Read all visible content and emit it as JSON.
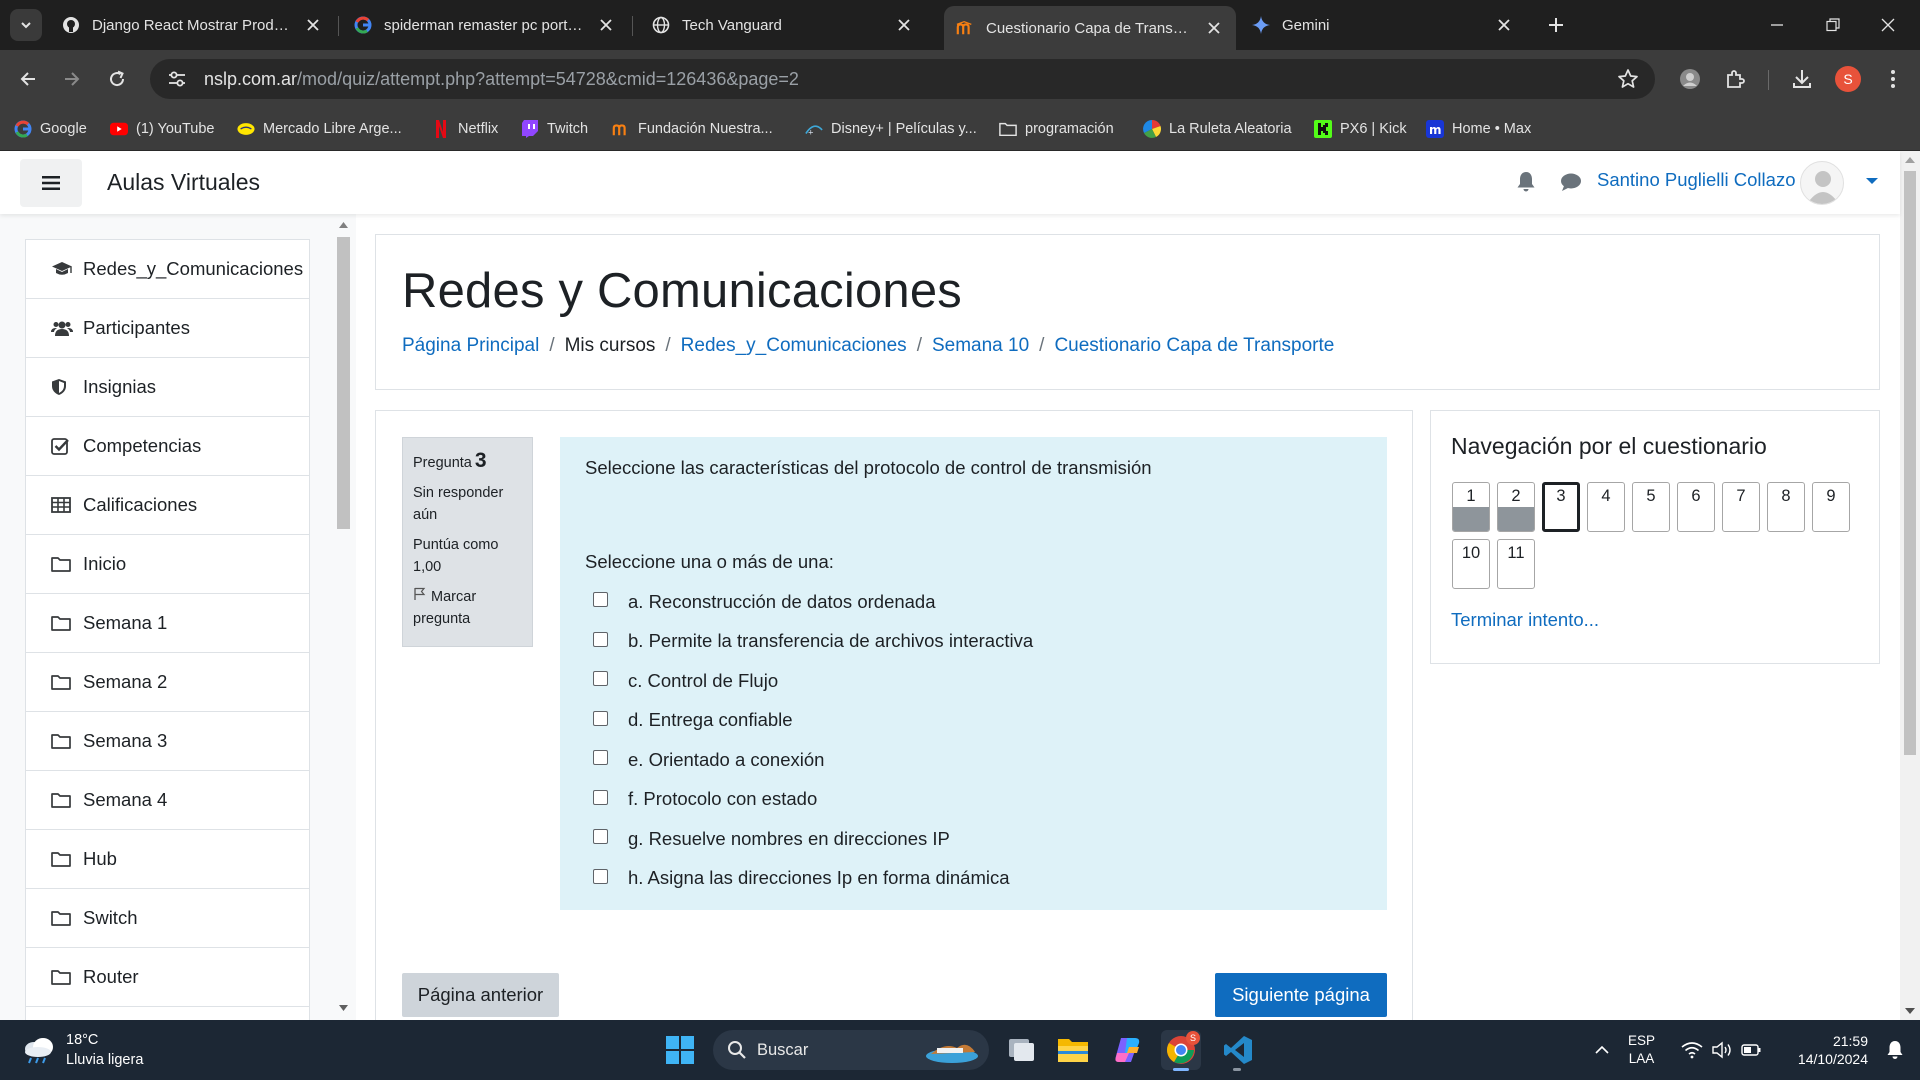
{
  "browser": {
    "tabs": [
      {
        "title": "Django React Mostrar Producto",
        "icon": "github-icon"
      },
      {
        "title": "spiderman remaster pc portada",
        "icon": "google-icon"
      },
      {
        "title": "Tech Vanguard",
        "icon": "globe-icon"
      },
      {
        "title": "Cuestionario Capa de Transport",
        "icon": "moodle-icon",
        "active": true
      },
      {
        "title": "Gemini",
        "icon": "gemini-icon"
      }
    ],
    "url": {
      "host": "nslp.com.ar",
      "path": "/mod/quiz/attempt.php?attempt=54728&cmid=126436&page=2"
    },
    "profile_initial": "S",
    "bookmarks": [
      {
        "label": "Google",
        "icon": "google-icon"
      },
      {
        "label": "(1) YouTube",
        "icon": "youtube-icon"
      },
      {
        "label": "Mercado Libre Arge...",
        "icon": "mercadolibre-icon"
      },
      {
        "label": "Netflix",
        "icon": "netflix-icon"
      },
      {
        "label": "Twitch",
        "icon": "twitch-icon"
      },
      {
        "label": "Fundación Nuestra...",
        "icon": "moodle-icon"
      },
      {
        "label": "Disney+ | Películas y...",
        "icon": "disney-icon"
      },
      {
        "label": "programación",
        "icon": "folder-icon"
      },
      {
        "label": "La Ruleta Aleatoria",
        "icon": "wheel-icon"
      },
      {
        "label": "PX6 | Kick",
        "icon": "kick-icon"
      },
      {
        "label": "Home • Max",
        "icon": "max-icon"
      }
    ]
  },
  "moodle": {
    "brand": "Aulas Virtuales",
    "user_name": "Santino Puglielli Collazo",
    "drawer": [
      {
        "label": "Redes_y_Comunicaciones",
        "icon": "graduation-cap-icon"
      },
      {
        "label": "Participantes",
        "icon": "users-icon"
      },
      {
        "label": "Insignias",
        "icon": "shield-icon"
      },
      {
        "label": "Competencias",
        "icon": "check-square-icon"
      },
      {
        "label": "Calificaciones",
        "icon": "table-icon"
      },
      {
        "label": "Inicio",
        "icon": "folder-icon"
      },
      {
        "label": "Semana 1",
        "icon": "folder-icon"
      },
      {
        "label": "Semana 2",
        "icon": "folder-icon"
      },
      {
        "label": "Semana 3",
        "icon": "folder-icon"
      },
      {
        "label": "Semana 4",
        "icon": "folder-icon"
      },
      {
        "label": "Hub",
        "icon": "folder-icon"
      },
      {
        "label": "Switch",
        "icon": "folder-icon"
      },
      {
        "label": "Router",
        "icon": "folder-icon"
      }
    ],
    "course_title": "Redes y Comunicaciones",
    "breadcrumb": [
      {
        "label": "Página Principal",
        "link": true
      },
      {
        "label": "Mis cursos",
        "link": false
      },
      {
        "label": "Redes_y_Comunicaciones",
        "link": true
      },
      {
        "label": "Semana 10",
        "link": true
      },
      {
        "label": "Cuestionario Capa de Transporte",
        "link": true
      }
    ],
    "question": {
      "label": "Pregunta",
      "number": "3",
      "status": "Sin responder aún",
      "score": "Puntúa como 1,00",
      "flag_label": "Marcar pregunta",
      "text": "Seleccione las características del protocolo de control de transmisión",
      "prompt": "Seleccione una o más de una:",
      "answers": [
        "a. Reconstrucción de datos ordenada",
        "b. Permite la transferencia de archivos interactiva",
        "c. Control de Flujo",
        "d. Entrega confiable",
        "e. Orientado a conexión",
        "f. Protocolo con estado",
        "g. Resuelve nombres en direcciones IP",
        "h. Asigna las direcciones Ip en forma dinámica"
      ]
    },
    "prev_button": "Página anterior",
    "next_button": "Siguiente página",
    "quiz_nav": {
      "title": "Navegación por el cuestionario",
      "buttons": [
        {
          "label": "1",
          "state": "answered"
        },
        {
          "label": "2",
          "state": "answered"
        },
        {
          "label": "3",
          "state": "current"
        },
        {
          "label": "4",
          "state": "unanswered"
        },
        {
          "label": "5",
          "state": "unanswered"
        },
        {
          "label": "6",
          "state": "unanswered"
        },
        {
          "label": "7",
          "state": "unanswered"
        },
        {
          "label": "8",
          "state": "unanswered"
        },
        {
          "label": "9",
          "state": "unanswered"
        },
        {
          "label": "10",
          "state": "unanswered"
        },
        {
          "label": "11",
          "state": "unanswered"
        }
      ],
      "finish_link": "Terminar intento..."
    }
  },
  "taskbar": {
    "weather_temp": "18°C",
    "weather_desc": "Lluvia ligera",
    "search_label": "Buscar",
    "lang_top": "ESP",
    "lang_bottom": "LAA",
    "time": "21:59",
    "date": "14/10/2024",
    "chrome_badge": "S"
  },
  "colors": {
    "accent": "#0f6cbf",
    "question_bg": "#def2f8",
    "info_bg": "#dee2e6",
    "taskbar": "#1c2734"
  }
}
